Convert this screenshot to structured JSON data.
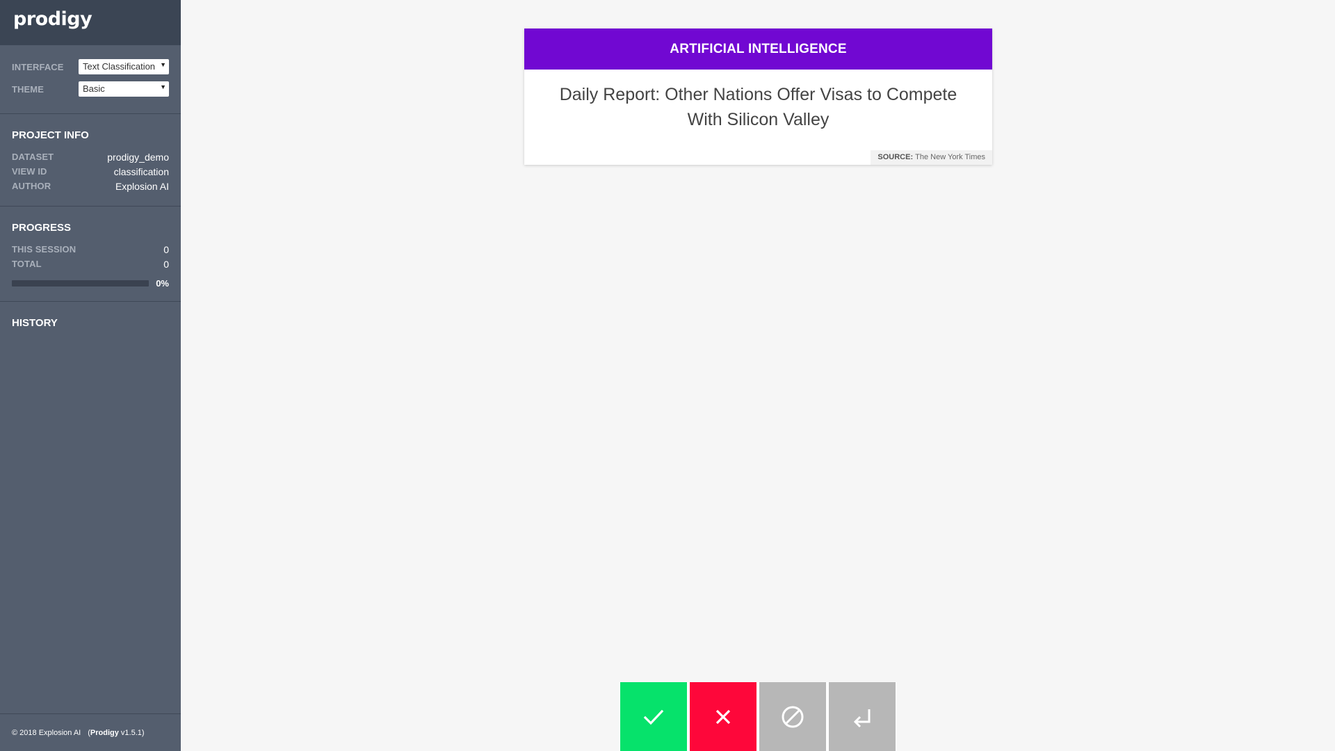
{
  "sidebar": {
    "logo": "prodigy",
    "settings": {
      "interface_label": "INTERFACE",
      "interface_value": "Text Classification",
      "theme_label": "THEME",
      "theme_value": "Basic"
    },
    "project_info": {
      "heading": "PROJECT INFO",
      "rows": [
        {
          "key": "DATASET",
          "value": "prodigy_demo"
        },
        {
          "key": "VIEW ID",
          "value": "classification"
        },
        {
          "key": "AUTHOR",
          "value": "Explosion AI"
        }
      ]
    },
    "progress": {
      "heading": "PROGRESS",
      "this_session_label": "THIS SESSION",
      "this_session_value": "0",
      "total_label": "TOTAL",
      "total_value": "0",
      "percent": 0,
      "percent_label": "0%"
    },
    "history": {
      "heading": "HISTORY"
    },
    "footer": {
      "copyright": "© 2018 Explosion AI",
      "version_open": "(",
      "product": "Prodigy",
      "version": " v1.5.1)"
    }
  },
  "card": {
    "label": "ARTIFICIAL INTELLIGENCE",
    "text": "Daily Report: Other Nations Offer Visas to Compete With Silicon Valley",
    "meta_key": "SOURCE:",
    "meta_value": "The New York Times"
  },
  "actions": [
    {
      "name": "accept",
      "icon": "check-icon"
    },
    {
      "name": "reject",
      "icon": "close-icon"
    },
    {
      "name": "ignore",
      "icon": "ban-icon"
    },
    {
      "name": "undo",
      "icon": "return-icon"
    }
  ],
  "colors": {
    "accept": "#06e26b",
    "reject": "#fe073a",
    "ignore": "#b7b7b7",
    "label_bg": "#7108d2",
    "sidebar_bg": "#545e6e"
  }
}
